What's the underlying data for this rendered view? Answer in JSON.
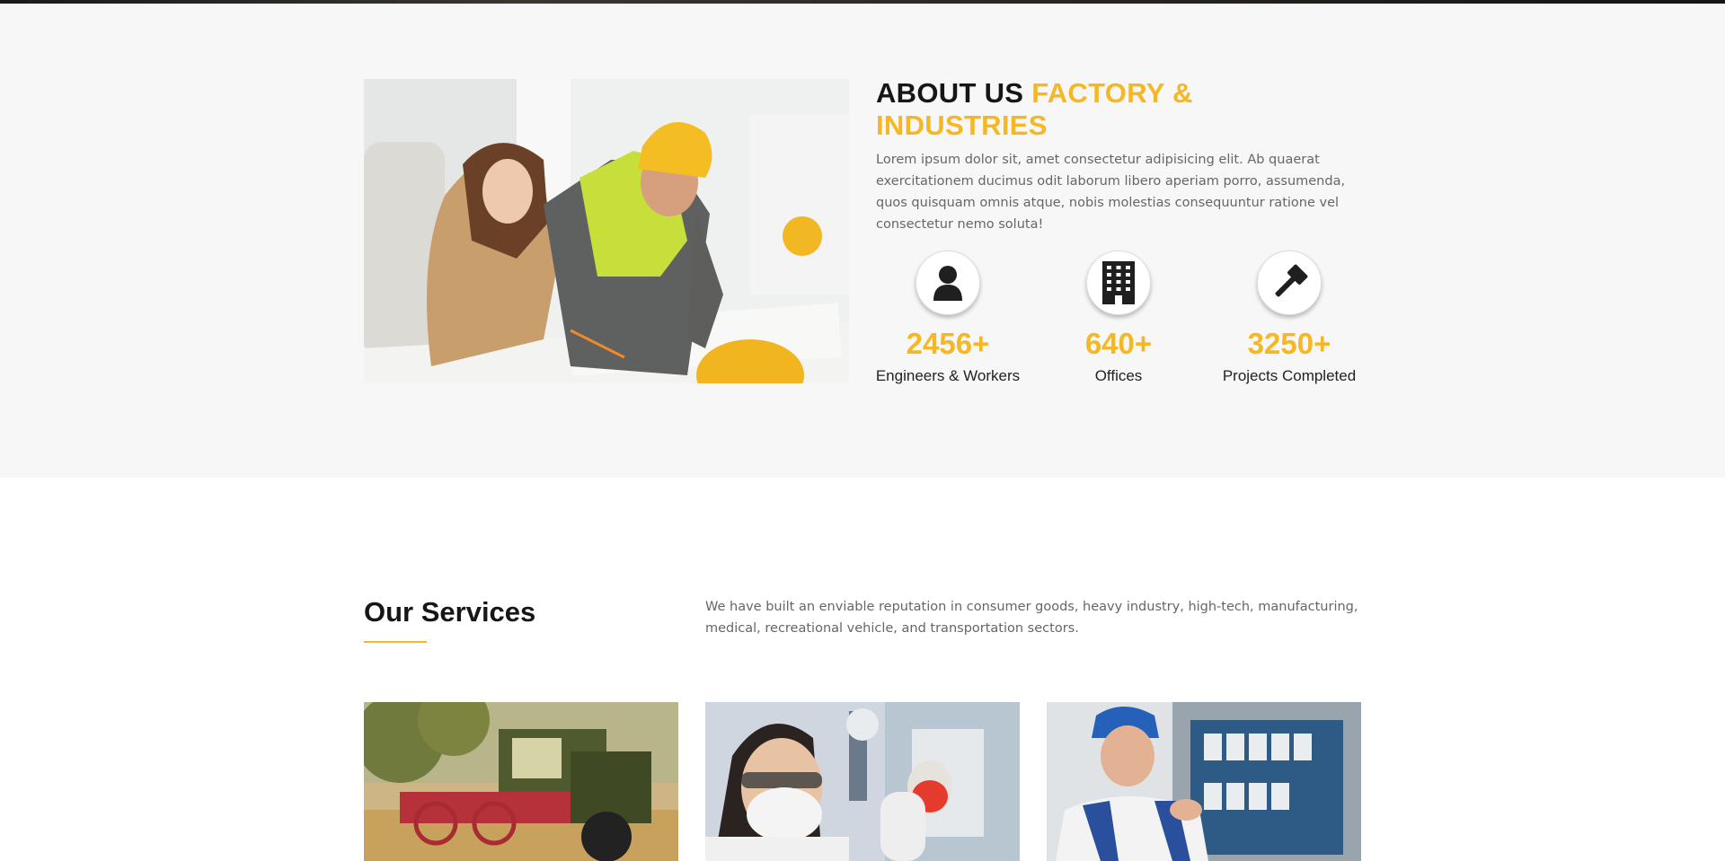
{
  "about": {
    "title_part1": "ABOUT US ",
    "title_part2": "FACTORY & INDUSTRIES",
    "text": "Lorem ipsum dolor sit, amet consectetur adipisicing elit. Ab quaerat exercitationem ducimus odit laborum libero aperiam porro, assumenda, quos quisquam omnis atque, nobis molestias consequuntur ratione vel consectetur nemo soluta!",
    "photo": "engineer-and-architect-photo",
    "stats": [
      {
        "icon": "user-icon",
        "number": "2456+",
        "label": "Engineers & Workers"
      },
      {
        "icon": "building-icon",
        "number": "640+",
        "label": "Offices"
      },
      {
        "icon": "gavel-icon",
        "number": "3250+",
        "label": "Projects Completed"
      }
    ]
  },
  "services": {
    "title": "Our Services",
    "text": "We have built an enviable reputation in consumer goods, heavy industry, high-tech, manufacturing, medical, recreational vehicle, and transportation sectors.",
    "cards": [
      {
        "image": "combine-harvester-photo"
      },
      {
        "image": "laboratory-scientist-photo"
      },
      {
        "image": "electrician-photo"
      }
    ]
  },
  "colors": {
    "accent": "#f5b724",
    "heading": "#161616",
    "body_text": "#666666",
    "about_bg": "#f6f7f6"
  }
}
